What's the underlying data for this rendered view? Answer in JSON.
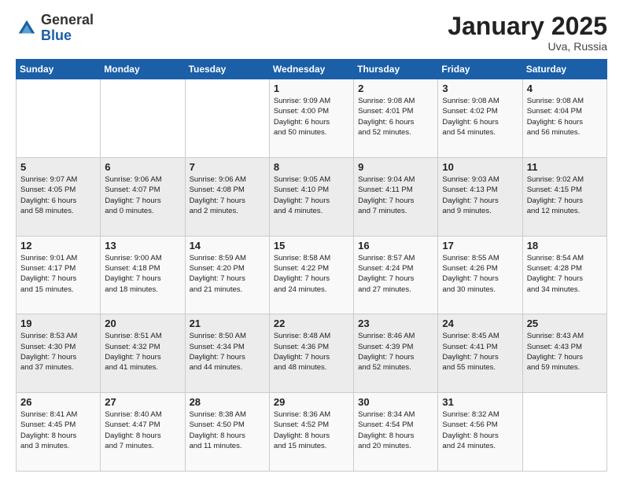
{
  "header": {
    "logo": {
      "general": "General",
      "blue": "Blue"
    },
    "title": "January 2025",
    "location": "Uva, Russia"
  },
  "calendar": {
    "days_of_week": [
      "Sunday",
      "Monday",
      "Tuesday",
      "Wednesday",
      "Thursday",
      "Friday",
      "Saturday"
    ],
    "weeks": [
      [
        {
          "day": "",
          "info": ""
        },
        {
          "day": "",
          "info": ""
        },
        {
          "day": "",
          "info": ""
        },
        {
          "day": "1",
          "info": "Sunrise: 9:09 AM\nSunset: 4:00 PM\nDaylight: 6 hours\nand 50 minutes."
        },
        {
          "day": "2",
          "info": "Sunrise: 9:08 AM\nSunset: 4:01 PM\nDaylight: 6 hours\nand 52 minutes."
        },
        {
          "day": "3",
          "info": "Sunrise: 9:08 AM\nSunset: 4:02 PM\nDaylight: 6 hours\nand 54 minutes."
        },
        {
          "day": "4",
          "info": "Sunrise: 9:08 AM\nSunset: 4:04 PM\nDaylight: 6 hours\nand 56 minutes."
        }
      ],
      [
        {
          "day": "5",
          "info": "Sunrise: 9:07 AM\nSunset: 4:05 PM\nDaylight: 6 hours\nand 58 minutes."
        },
        {
          "day": "6",
          "info": "Sunrise: 9:06 AM\nSunset: 4:07 PM\nDaylight: 7 hours\nand 0 minutes."
        },
        {
          "day": "7",
          "info": "Sunrise: 9:06 AM\nSunset: 4:08 PM\nDaylight: 7 hours\nand 2 minutes."
        },
        {
          "day": "8",
          "info": "Sunrise: 9:05 AM\nSunset: 4:10 PM\nDaylight: 7 hours\nand 4 minutes."
        },
        {
          "day": "9",
          "info": "Sunrise: 9:04 AM\nSunset: 4:11 PM\nDaylight: 7 hours\nand 7 minutes."
        },
        {
          "day": "10",
          "info": "Sunrise: 9:03 AM\nSunset: 4:13 PM\nDaylight: 7 hours\nand 9 minutes."
        },
        {
          "day": "11",
          "info": "Sunrise: 9:02 AM\nSunset: 4:15 PM\nDaylight: 7 hours\nand 12 minutes."
        }
      ],
      [
        {
          "day": "12",
          "info": "Sunrise: 9:01 AM\nSunset: 4:17 PM\nDaylight: 7 hours\nand 15 minutes."
        },
        {
          "day": "13",
          "info": "Sunrise: 9:00 AM\nSunset: 4:18 PM\nDaylight: 7 hours\nand 18 minutes."
        },
        {
          "day": "14",
          "info": "Sunrise: 8:59 AM\nSunset: 4:20 PM\nDaylight: 7 hours\nand 21 minutes."
        },
        {
          "day": "15",
          "info": "Sunrise: 8:58 AM\nSunset: 4:22 PM\nDaylight: 7 hours\nand 24 minutes."
        },
        {
          "day": "16",
          "info": "Sunrise: 8:57 AM\nSunset: 4:24 PM\nDaylight: 7 hours\nand 27 minutes."
        },
        {
          "day": "17",
          "info": "Sunrise: 8:55 AM\nSunset: 4:26 PM\nDaylight: 7 hours\nand 30 minutes."
        },
        {
          "day": "18",
          "info": "Sunrise: 8:54 AM\nSunset: 4:28 PM\nDaylight: 7 hours\nand 34 minutes."
        }
      ],
      [
        {
          "day": "19",
          "info": "Sunrise: 8:53 AM\nSunset: 4:30 PM\nDaylight: 7 hours\nand 37 minutes."
        },
        {
          "day": "20",
          "info": "Sunrise: 8:51 AM\nSunset: 4:32 PM\nDaylight: 7 hours\nand 41 minutes."
        },
        {
          "day": "21",
          "info": "Sunrise: 8:50 AM\nSunset: 4:34 PM\nDaylight: 7 hours\nand 44 minutes."
        },
        {
          "day": "22",
          "info": "Sunrise: 8:48 AM\nSunset: 4:36 PM\nDaylight: 7 hours\nand 48 minutes."
        },
        {
          "day": "23",
          "info": "Sunrise: 8:46 AM\nSunset: 4:39 PM\nDaylight: 7 hours\nand 52 minutes."
        },
        {
          "day": "24",
          "info": "Sunrise: 8:45 AM\nSunset: 4:41 PM\nDaylight: 7 hours\nand 55 minutes."
        },
        {
          "day": "25",
          "info": "Sunrise: 8:43 AM\nSunset: 4:43 PM\nDaylight: 7 hours\nand 59 minutes."
        }
      ],
      [
        {
          "day": "26",
          "info": "Sunrise: 8:41 AM\nSunset: 4:45 PM\nDaylight: 8 hours\nand 3 minutes."
        },
        {
          "day": "27",
          "info": "Sunrise: 8:40 AM\nSunset: 4:47 PM\nDaylight: 8 hours\nand 7 minutes."
        },
        {
          "day": "28",
          "info": "Sunrise: 8:38 AM\nSunset: 4:50 PM\nDaylight: 8 hours\nand 11 minutes."
        },
        {
          "day": "29",
          "info": "Sunrise: 8:36 AM\nSunset: 4:52 PM\nDaylight: 8 hours\nand 15 minutes."
        },
        {
          "day": "30",
          "info": "Sunrise: 8:34 AM\nSunset: 4:54 PM\nDaylight: 8 hours\nand 20 minutes."
        },
        {
          "day": "31",
          "info": "Sunrise: 8:32 AM\nSunset: 4:56 PM\nDaylight: 8 hours\nand 24 minutes."
        },
        {
          "day": "",
          "info": ""
        }
      ]
    ]
  }
}
